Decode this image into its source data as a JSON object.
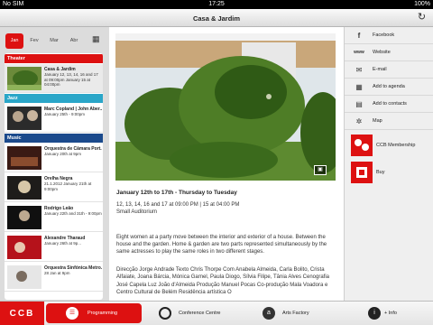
{
  "status": {
    "carrier": "No SIM",
    "time": "17:25",
    "battery": "100%"
  },
  "header": {
    "title": "Casa & Jardim"
  },
  "months": [
    "Jan",
    "Fev",
    "Mar",
    "Abr"
  ],
  "sections": [
    {
      "label": "Theater",
      "color": "#d11111"
    },
    {
      "label": "Jazz",
      "color": "#2aa6c8"
    },
    {
      "label": "Music",
      "color": "#1b4a8c"
    }
  ],
  "events": [
    {
      "name": "Casa & Jardim",
      "when": "January 12, 13, 14, 16 and 17 at 09:00pm January 15 at 04:00pm"
    },
    {
      "name": "Marc Copland | John Aber...",
      "when": "January 25th - 9:00pm"
    },
    {
      "name": "Orquestra de Câmara Port...",
      "when": "January 20th at 9pm"
    },
    {
      "name": "Orelha Negra",
      "when": "21.1.2012 January 21th at 9:00pm"
    },
    {
      "name": "Rodrigo Leão",
      "when": "January 22th and 31th - 9:00pm"
    },
    {
      "name": "Alexandre Tharaud",
      "when": "January 26th at 9p..."
    },
    {
      "name": "Orquestra Sinfónica Metro...",
      "when": "28 Jan at 9pm"
    }
  ],
  "detail": {
    "title": "January 12th to 17th - Thursday to Tuesday",
    "time": "12, 13, 14, 16 and 17 at 09:00 PM | 15 at 04:00 PM",
    "venue": "Small Auditorium",
    "description": "Eight women at a party move between the interior and exterior of a house. Between the house and the garden. Home & garden are two parts represented simultaneously by the same actresses to play the same roles in two different stages.",
    "credits": "Direcção Jorge Andrade Texto Chris Thorpe Com Anabela Almeida, Carla Bolito, Crista Alfaiate, Joana Bárcia, Mónica Garnel, Paula Diogo, Sílvia Filipe, Tânia Alves Cenografia José Capela Luz João d'Almeida Produção Manuel Pocas Co-produção Mala Voadora e Centro Cultural de Belém Residência artística O"
  },
  "actions": [
    {
      "label": "Facebook",
      "icon": "facebook-icon",
      "glyph": "f"
    },
    {
      "label": "Website",
      "icon": "website-icon",
      "glyph": "www"
    },
    {
      "label": "E-mail",
      "icon": "email-icon",
      "glyph": "✉"
    },
    {
      "label": "Add to agenda",
      "icon": "add-agenda-icon",
      "glyph": "▦"
    },
    {
      "label": "Add to contacts",
      "icon": "add-contacts-icon",
      "glyph": "▤"
    },
    {
      "label": "Map",
      "icon": "map-icon",
      "glyph": "✲"
    }
  ],
  "membership": {
    "label": "CCB Membership"
  },
  "buy": {
    "label": "Buy"
  },
  "tabs": {
    "logo": "CCB",
    "programming": "Programming",
    "conference": "Conference Centre",
    "arts": "Arts Factory",
    "info": "+ Info"
  },
  "colors": {
    "brand": "#d11111",
    "jazz": "#2aa6c8",
    "music": "#1b4a8c"
  }
}
